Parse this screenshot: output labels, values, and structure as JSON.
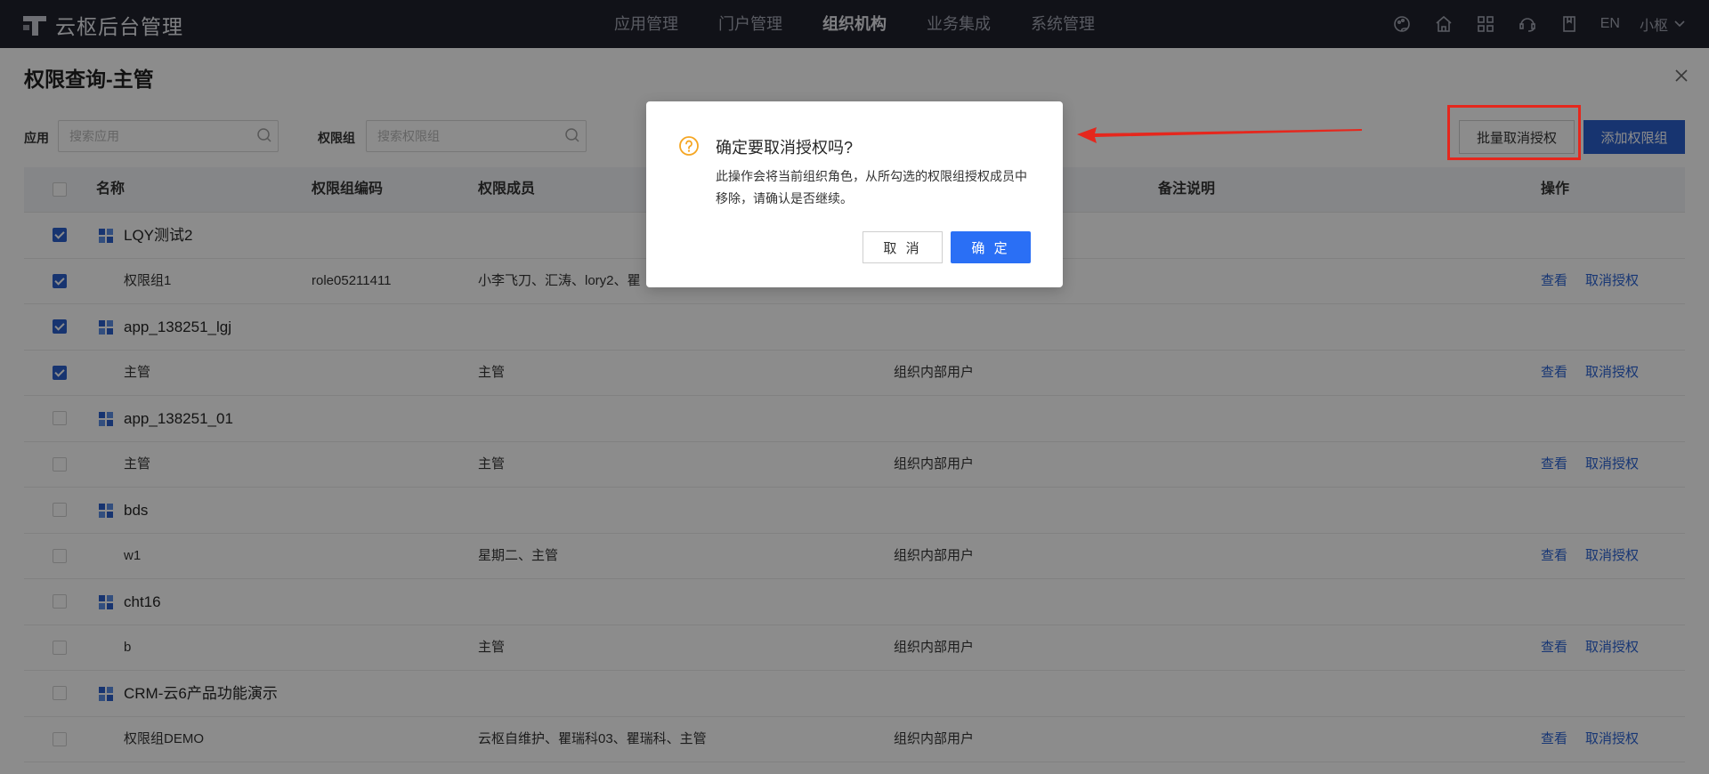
{
  "header": {
    "app_title": "云枢后台管理",
    "nav": [
      "应用管理",
      "门户管理",
      "组织机构",
      "业务集成",
      "系统管理"
    ],
    "active_nav": "组织机构",
    "icons": [
      "skin-icon",
      "home-icon",
      "apps-grid-icon",
      "support-icon",
      "document-icon"
    ],
    "lang": "EN",
    "user": "小枢"
  },
  "page": {
    "title": "权限查询-主管"
  },
  "filters": {
    "app_label": "应用",
    "app_placeholder": "搜索应用",
    "group_label": "权限组",
    "group_placeholder": "搜索权限组"
  },
  "actions": {
    "batch_revoke": "批量取消授权",
    "add_group": "添加权限组"
  },
  "table": {
    "columns": {
      "name": "名称",
      "code": "权限组编码",
      "members": "权限成员",
      "remark": "备注说明",
      "ops": "操作"
    },
    "op_view": "查看",
    "op_revoke": "取消授权",
    "rows": [
      {
        "type": "group",
        "name": "LQY测试2",
        "checked": true
      },
      {
        "type": "child",
        "name": "权限组1",
        "code": "role05211411",
        "members": "小李飞刀、汇涛、lory2、瞿",
        "scope": "",
        "checked": true
      },
      {
        "type": "group",
        "name": "app_138251_lgj",
        "checked": true
      },
      {
        "type": "child",
        "name": "主管",
        "code": "",
        "members": "主管",
        "scope": "组织内部用户",
        "checked": true
      },
      {
        "type": "group",
        "name": "app_138251_01",
        "checked": false
      },
      {
        "type": "child",
        "name": "主管",
        "code": "",
        "members": "主管",
        "scope": "组织内部用户",
        "checked": false
      },
      {
        "type": "group",
        "name": "bds",
        "checked": false
      },
      {
        "type": "child",
        "name": "w1",
        "code": "",
        "members": "星期二、主管",
        "scope": "组织内部用户",
        "checked": false
      },
      {
        "type": "group",
        "name": "cht16",
        "checked": false
      },
      {
        "type": "child",
        "name": "b",
        "code": "",
        "members": "主管",
        "scope": "组织内部用户",
        "checked": false
      },
      {
        "type": "group",
        "name": "CRM-云6产品功能演示",
        "checked": false
      },
      {
        "type": "child",
        "name": "权限组DEMO",
        "code": "",
        "members": "云枢自维护、瞿瑞科03、瞿瑞科、主管",
        "scope": "组织内部用户",
        "checked": false
      }
    ]
  },
  "dialog": {
    "title": "确定要取消授权吗?",
    "text": "此操作会将当前组织角色，从所勾选的权限组授权成员中移除，请确认是否继续。",
    "cancel": "取 消",
    "ok": "确 定"
  },
  "colors": {
    "topbar": "#20222d",
    "primary": "#2a5fcc",
    "link": "#2a63d4",
    "highlight": "#e5271d",
    "warning": "#f5a623"
  }
}
